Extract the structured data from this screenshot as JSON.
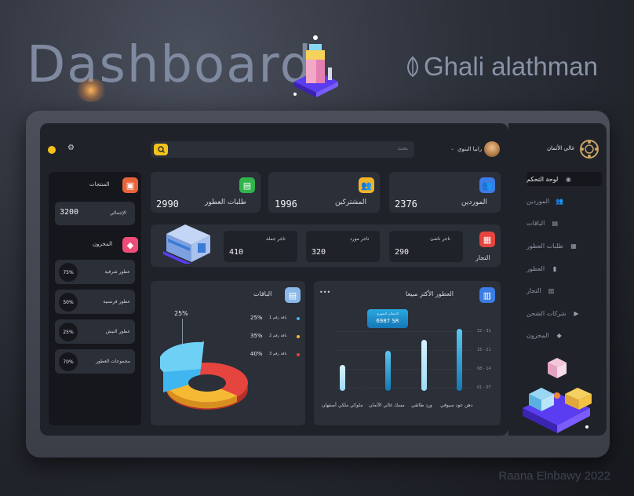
{
  "hero": {
    "title": "Dashboard",
    "author": "Ghali alathman",
    "signature": "Raana Elnbawy",
    "year": "2022"
  },
  "brand": {
    "name": "غالي الأثمان"
  },
  "user": {
    "name": "رانيا البنوي"
  },
  "search": {
    "placeholder": "بحث"
  },
  "nav": [
    {
      "label": "لوحة التحكم",
      "icon": "dashboard-icon"
    },
    {
      "label": "الموردين",
      "icon": "users-icon"
    },
    {
      "label": "الباقات",
      "icon": "file-icon"
    },
    {
      "label": "طلبات العطور",
      "icon": "clipboard-icon"
    },
    {
      "label": "العطور",
      "icon": "perfume-icon"
    },
    {
      "label": "التجار",
      "icon": "store-icon"
    },
    {
      "label": "شركات الشحن",
      "icon": "truck-icon"
    },
    {
      "label": "المخزون",
      "icon": "box-icon"
    }
  ],
  "stats": {
    "suppliers": {
      "label": "الموردين",
      "value": "2376"
    },
    "subscribers": {
      "label": "المشتركين",
      "value": "1996"
    },
    "orders": {
      "label": "طلبات العطور",
      "value": "2990"
    }
  },
  "traders": {
    "label": "التجار",
    "items": [
      {
        "label": "تاجر ناشئ",
        "value": "290"
      },
      {
        "label": "تاجر مورد",
        "value": "320"
      },
      {
        "label": "تاجر جملة",
        "value": "410"
      }
    ]
  },
  "products": {
    "title": "المنتجات",
    "total_label": "الإجمالي",
    "total_value": "3200"
  },
  "inventory": {
    "title": "المخزون",
    "items": [
      {
        "label": "عطور شرقية",
        "percent": "75%"
      },
      {
        "label": "عطور فرنسية",
        "percent": "50%"
      },
      {
        "label": "عطور النيش",
        "percent": "25%"
      },
      {
        "label": "مجموعات العطور",
        "percent": "70%"
      }
    ]
  },
  "packages": {
    "title": "الباقات",
    "callout": "25%",
    "legend": [
      {
        "label": "باقة رقم 1",
        "percent": "25%",
        "color": "#3fb6f0"
      },
      {
        "label": "باقة رقم 2",
        "percent": "35%",
        "color": "#f5b934"
      },
      {
        "label": "باقة رقم 3",
        "percent": "40%",
        "color": "#e5453e"
      }
    ]
  },
  "bestsellers": {
    "title": "العطور الأكثر مبيعا",
    "more": "•••",
    "tooltip_label": "الإجمالي الشهري",
    "tooltip_value": "6987 SR"
  },
  "chart_data": {
    "type": "bar",
    "title": "العطور الأكثر مبيعا",
    "categories": [
      "دهن عود سيوفي",
      "ورد طائفي",
      "مسك غالي الأثمان",
      "ملوكي ملكي أصفهان"
    ],
    "values": [
      29,
      24,
      19,
      12
    ],
    "y_ticks": [
      "22 - 31",
      "15 - 21",
      "08 - 14",
      "01 - 07"
    ],
    "ylim": [
      0,
      31
    ]
  },
  "colors": {
    "accent_yellow": "#f4c21b",
    "accent_blue": "#3b7ce6",
    "teal": "#1ba6d6"
  }
}
